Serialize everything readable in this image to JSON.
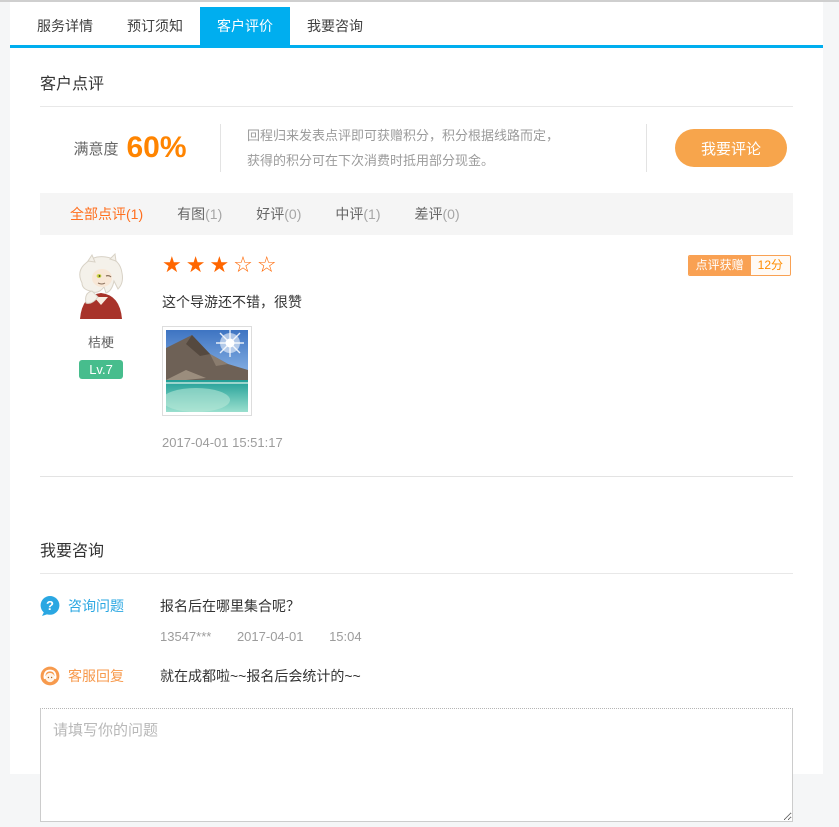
{
  "tabs": [
    {
      "label": "服务详情",
      "active": false
    },
    {
      "label": "预订须知",
      "active": false
    },
    {
      "label": "客户评价",
      "active": true
    },
    {
      "label": "我要咨询",
      "active": false
    }
  ],
  "reviews": {
    "heading": "客户点评",
    "satisfaction": {
      "label": "满意度",
      "value": "60%"
    },
    "promo": {
      "line1": "回程归来发表点评即可获赠积分，积分根据线路而定，",
      "line2": "获得的积分可在下次消费时抵用部分现金。"
    },
    "comment_button": "我要评论",
    "filters": [
      {
        "label": "全部点评",
        "count": "(1)",
        "active": true
      },
      {
        "label": "有图",
        "count": "(1)",
        "active": false
      },
      {
        "label": "好评",
        "count": "(0)",
        "active": false
      },
      {
        "label": "中评",
        "count": "(1)",
        "active": false
      },
      {
        "label": "差评",
        "count": "(0)",
        "active": false
      }
    ],
    "review": {
      "username": "桔梗",
      "level": "Lv.7",
      "rating": 3,
      "rating_max": 5,
      "stars_filled": "★★★",
      "stars_empty": "☆☆",
      "text": "这个导游还不错，很赞",
      "photo": "mountain-lake-photo",
      "timestamp": "2017-04-01 15:51:17",
      "reward_label": "点评获赠",
      "reward_value": "12分"
    }
  },
  "consult": {
    "heading": "我要咨询",
    "question": {
      "label": "咨询问题",
      "text": "报名后在哪里集合呢？",
      "user": "13547***",
      "date": "2017-04-01",
      "time": "15:04"
    },
    "answer": {
      "label": "客服回复",
      "text": "就在成都啦~~报名后会统计的~~"
    },
    "input_placeholder": "请填写你的问题"
  },
  "colors": {
    "accent_blue": "#00aeef",
    "link_blue": "#2aa7e2",
    "star_orange": "#ff6600",
    "satisfaction_orange": "#ff8400",
    "button_orange": "#f7a54c",
    "badge_orange": "#f9a153",
    "level_green": "#47bd8d"
  }
}
